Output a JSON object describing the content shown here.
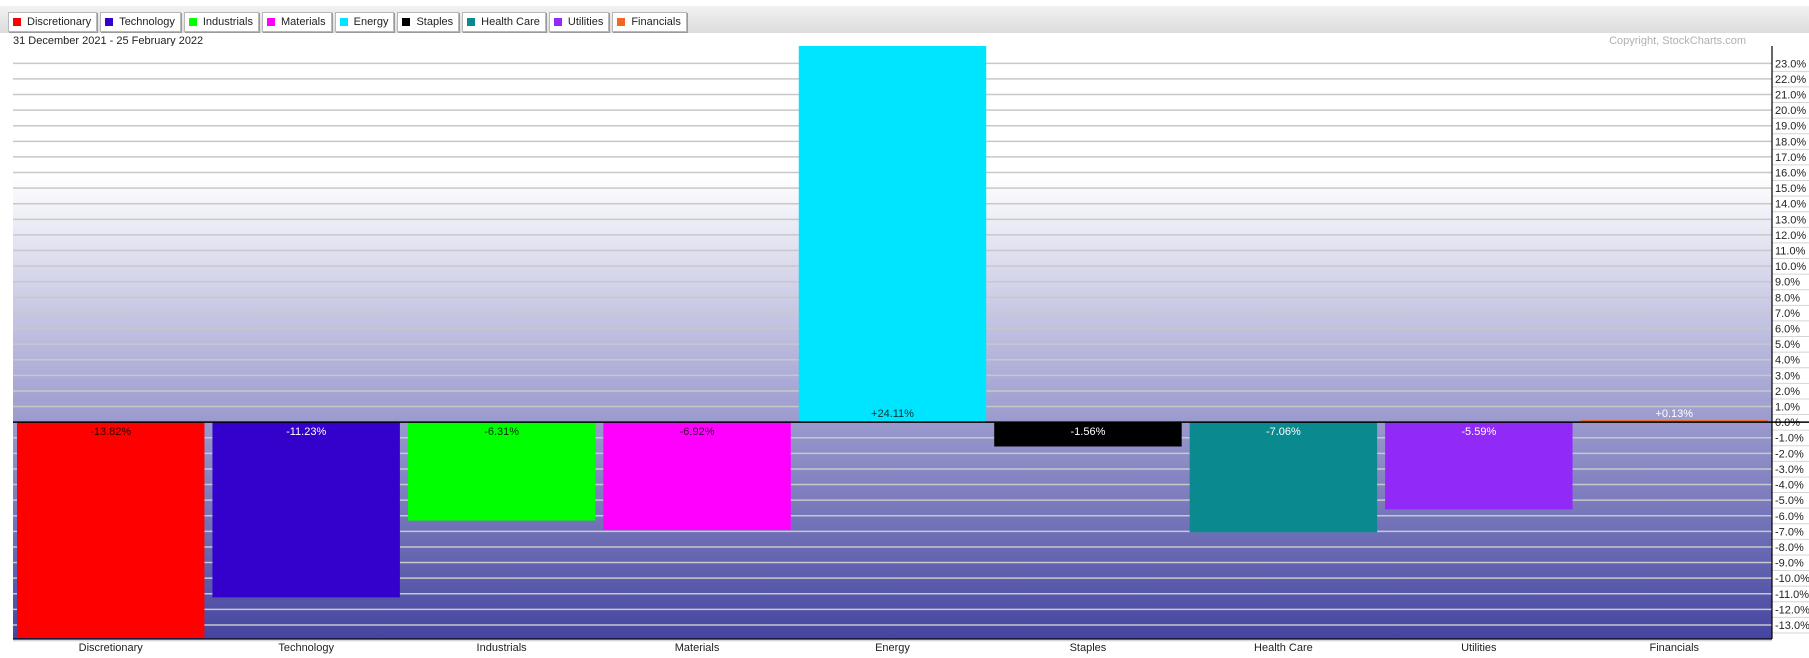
{
  "header": {
    "date_range": "31 December 2021 - 25 February 2022",
    "copyright": "Copyright, StockCharts.com"
  },
  "legend": [
    {
      "label": "Discretionary",
      "color": "#ff0000"
    },
    {
      "label": "Technology",
      "color": "#3300cc"
    },
    {
      "label": "Industrials",
      "color": "#00ff00"
    },
    {
      "label": "Materials",
      "color": "#ff00ff"
    },
    {
      "label": "Energy",
      "color": "#00e5ff"
    },
    {
      "label": "Staples",
      "color": "#000000"
    },
    {
      "label": "Health Care",
      "color": "#0a8a8f"
    },
    {
      "label": "Utilities",
      "color": "#9129f7"
    },
    {
      "label": "Financials",
      "color": "#f26522"
    }
  ],
  "chart_data": {
    "type": "bar",
    "title": "",
    "xlabel": "",
    "ylabel": "",
    "categories": [
      "Discretionary",
      "Technology",
      "Industrials",
      "Materials",
      "Energy",
      "Staples",
      "Health Care",
      "Utilities",
      "Financials"
    ],
    "values": [
      -13.82,
      -11.23,
      -6.31,
      -6.92,
      24.11,
      -1.56,
      -7.06,
      -5.59,
      0.13
    ],
    "value_labels": [
      "-13.82%",
      "-11.23%",
      "-6.31%",
      "-6.92%",
      "+24.11%",
      "-1.56%",
      "-7.06%",
      "-5.59%",
      "+0.13%"
    ],
    "colors": [
      "#ff0000",
      "#3300cc",
      "#00ff00",
      "#ff00ff",
      "#00e5ff",
      "#000000",
      "#0a8a8f",
      "#9129f7",
      "#f26522"
    ],
    "label_colors": [
      "#330000",
      "#ffffff",
      "#003300",
      "#330033",
      "#003333",
      "#ffffff",
      "#ffffff",
      "#ffffff",
      "#ffffff"
    ],
    "ylim": [
      -13.9,
      24.11
    ],
    "yticks": [
      23,
      22,
      21,
      20,
      19,
      18,
      17,
      16,
      15,
      14,
      13,
      12,
      11,
      10,
      9,
      8,
      7,
      6,
      5,
      4,
      3,
      2,
      1,
      0,
      -1,
      -2,
      -3,
      -4,
      -5,
      -6,
      -7,
      -8,
      -9,
      -10,
      -11,
      -12,
      -13
    ],
    "ytick_format": "{v}.0%",
    "grid": true,
    "axis_position": "right",
    "legend_position": "top-left"
  }
}
